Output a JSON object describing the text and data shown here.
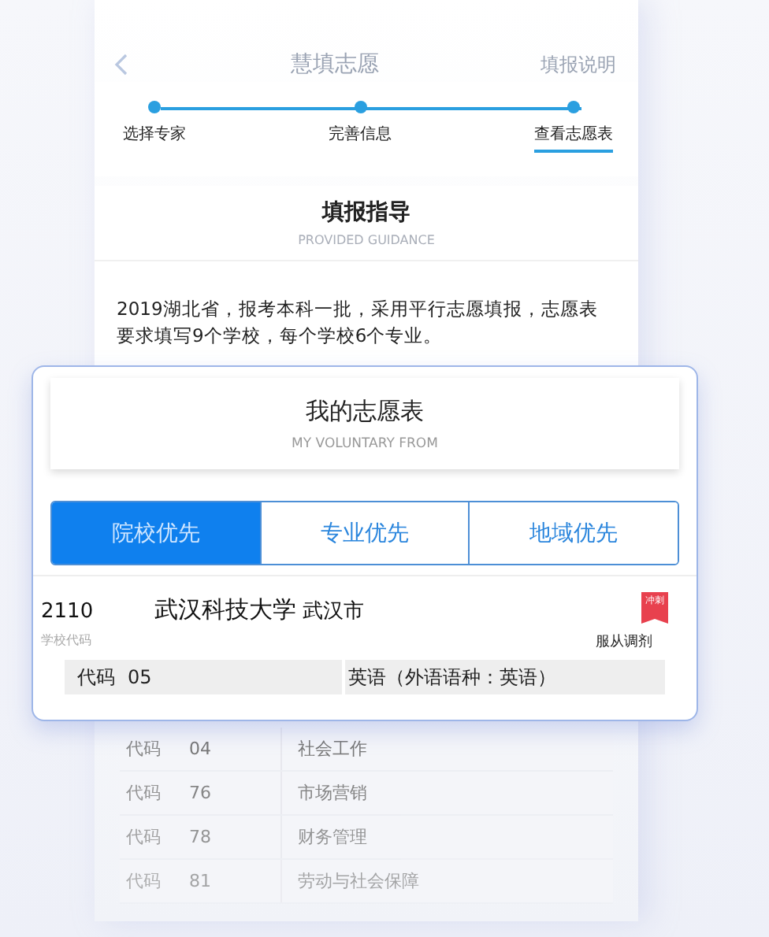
{
  "nav": {
    "title": "慧填志愿",
    "action": "填报说明"
  },
  "steps": [
    {
      "label": "选择专家",
      "selected": false
    },
    {
      "label": "完善信息",
      "selected": false
    },
    {
      "label": "查看志愿表",
      "selected": true
    }
  ],
  "guide": {
    "title": "填报指导",
    "subtitle": "PROVIDED GUIDANCE",
    "text": "2019湖北省，报考本科一批，采用平行志愿填报，志愿表要求填写9个学校，每个学校6个专业。"
  },
  "background_majors": [
    {
      "code_label": "代码",
      "code": "04",
      "name": "社会工作"
    },
    {
      "code_label": "代码",
      "code": "76",
      "name": "市场营销"
    },
    {
      "code_label": "代码",
      "code": "78",
      "name": "财务管理"
    },
    {
      "code_label": "代码",
      "code": "81",
      "name": "劳动与社会保障"
    }
  ],
  "form": {
    "title": "我的志愿表",
    "subtitle": "MY VOLUNTARY FROM",
    "tabs": [
      {
        "label": "院校优先",
        "selected": true
      },
      {
        "label": "专业优先",
        "selected": false
      },
      {
        "label": "地域优先",
        "selected": false
      }
    ],
    "school": {
      "code": "2110",
      "name": "武汉科技大学",
      "city": "武汉市",
      "code_caption": "学校代码",
      "badge": "冲刺",
      "note": "服从调剂",
      "major": {
        "code_label": "代码",
        "code": "05",
        "name": "英语（外语语种：英语）"
      }
    }
  }
}
